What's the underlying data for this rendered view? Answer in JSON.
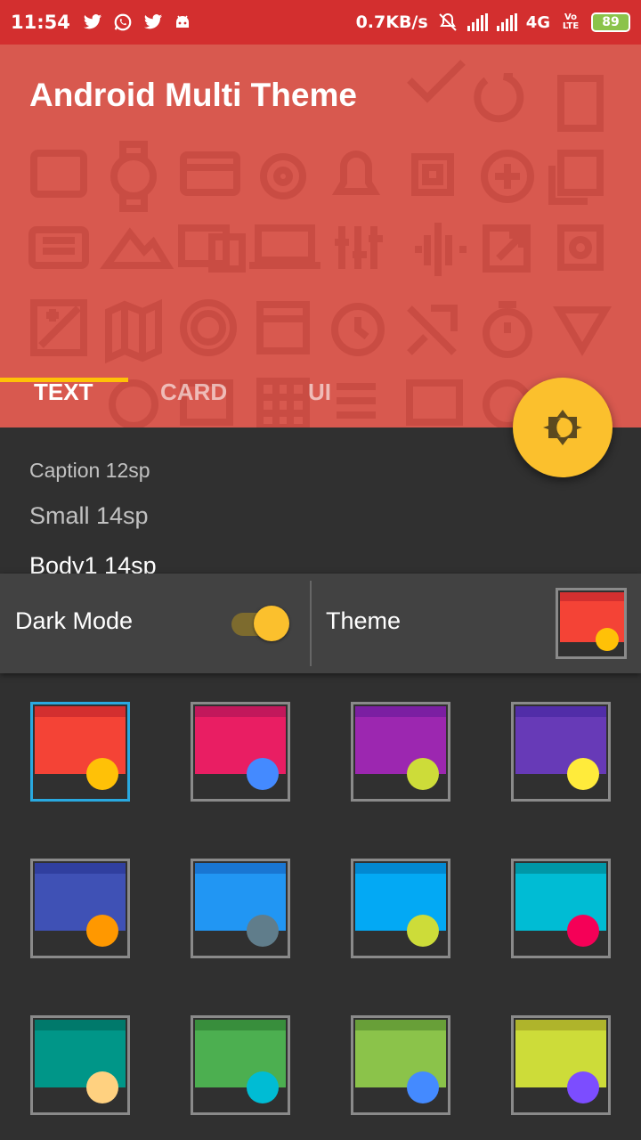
{
  "status_bar": {
    "time": "11:54",
    "speed": "0.7KB/s",
    "network": "4G",
    "volte": "Vo LTE",
    "battery": "89"
  },
  "app": {
    "title": "Android Multi Theme",
    "tabs": [
      "TEXT",
      "CARD",
      "UI"
    ],
    "active_tab": "TEXT"
  },
  "typography": {
    "caption": "Caption 12sp",
    "small": "Small 14sp",
    "body1": "Body1 14sp"
  },
  "settings": {
    "dark_mode_label": "Dark Mode",
    "dark_mode_on": true,
    "theme_label": "Theme"
  },
  "colors": {
    "status_bar": "#d32f2f",
    "header": "#d8594f",
    "accent": "#ffc107",
    "background": "#303030",
    "card": "#424242"
  },
  "themes": [
    {
      "dark": "#d32f2f",
      "primary": "#f44336",
      "accent": "#ffc107",
      "selected": true
    },
    {
      "dark": "#c2185b",
      "primary": "#e91e63",
      "accent": "#448aff",
      "selected": false
    },
    {
      "dark": "#7b1fa2",
      "primary": "#9c27b0",
      "accent": "#cddc39",
      "selected": false
    },
    {
      "dark": "#512da8",
      "primary": "#673ab7",
      "accent": "#ffeb3b",
      "selected": false
    },
    {
      "dark": "#303f9f",
      "primary": "#3f51b5",
      "accent": "#ff9800",
      "selected": false
    },
    {
      "dark": "#1976d2",
      "primary": "#2196f3",
      "accent": "#607d8b",
      "selected": false
    },
    {
      "dark": "#0288d1",
      "primary": "#03a9f4",
      "accent": "#cddc39",
      "selected": false
    },
    {
      "dark": "#0097a7",
      "primary": "#00bcd4",
      "accent": "#f50057",
      "selected": false
    },
    {
      "dark": "#00796b",
      "primary": "#009688",
      "accent": "#ffd180",
      "selected": false
    },
    {
      "dark": "#388e3c",
      "primary": "#4caf50",
      "accent": "#00bcd4",
      "selected": false
    },
    {
      "dark": "#689f38",
      "primary": "#8bc34a",
      "accent": "#448aff",
      "selected": false
    },
    {
      "dark": "#afb42b",
      "primary": "#cddc39",
      "accent": "#7c4dff",
      "selected": false
    }
  ],
  "icons": [
    "twitter-icon",
    "whatsapp-icon",
    "android-icon",
    "mute-icon",
    "signal-icon",
    "brightness-icon"
  ]
}
